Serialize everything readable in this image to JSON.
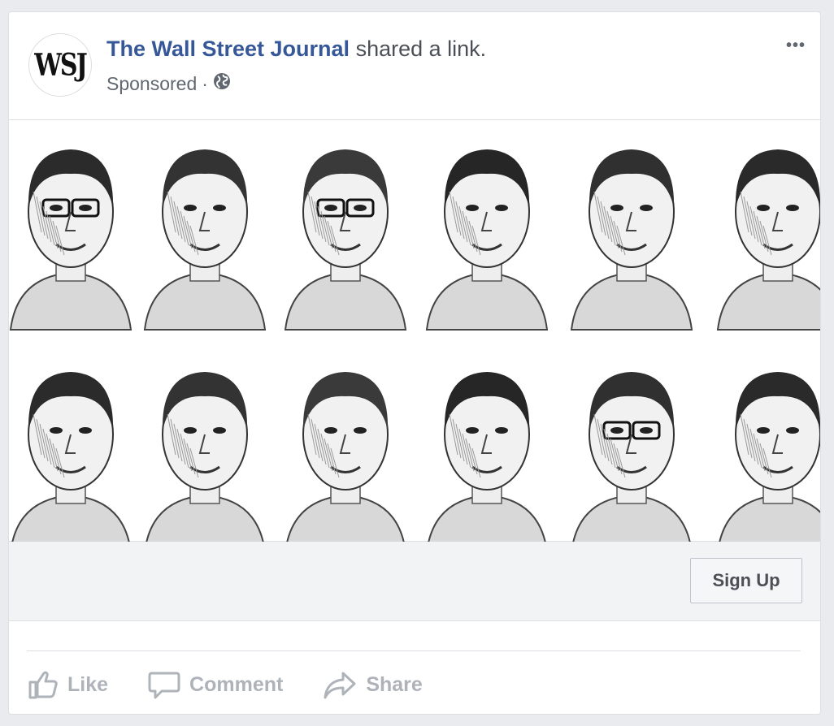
{
  "post": {
    "avatar_text": "WSJ",
    "page_name": "The Wall Street Journal",
    "shared_text": "shared a link.",
    "sponsored": "Sponsored",
    "separator": "·",
    "privacy_icon": "globe-icon",
    "more_icon": "more-icon",
    "more_text": "•••"
  },
  "image": {
    "description_icon": "portrait-grid",
    "portrait_count": 12
  },
  "cta": {
    "label": "Sign Up"
  },
  "actions": {
    "like": "Like",
    "comment": "Comment",
    "share": "Share"
  },
  "colors": {
    "link": "#365899",
    "muted": "#606770",
    "action": "#aeb3ba",
    "background": "#e9ebee"
  }
}
